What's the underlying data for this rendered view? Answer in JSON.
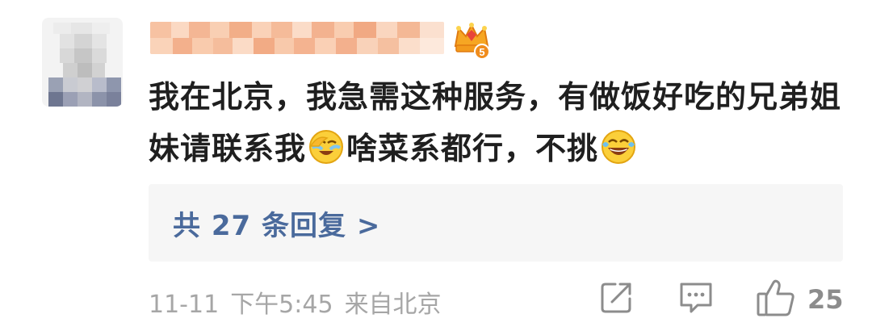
{
  "comment": {
    "body_part1": "我在北京，我急需这种服务，有做饭好吃的兄弟姐妹请联系我",
    "body_part2": "啥菜系都行，不挑",
    "emoji_1": "facepalm-laugh-emoji",
    "emoji_2": "laughing-tears-emoji",
    "badge_level": "5",
    "reply_link": "共 27 条回复 >",
    "date": "11-11",
    "time": "下午5:45",
    "source": "来自北京",
    "like_count": "25"
  },
  "colors": {
    "reply_link": "#4a6a9c",
    "meta_text": "#a6a6a6",
    "reply_bg": "#f6f6f6",
    "body_text": "#1f1f1f"
  }
}
